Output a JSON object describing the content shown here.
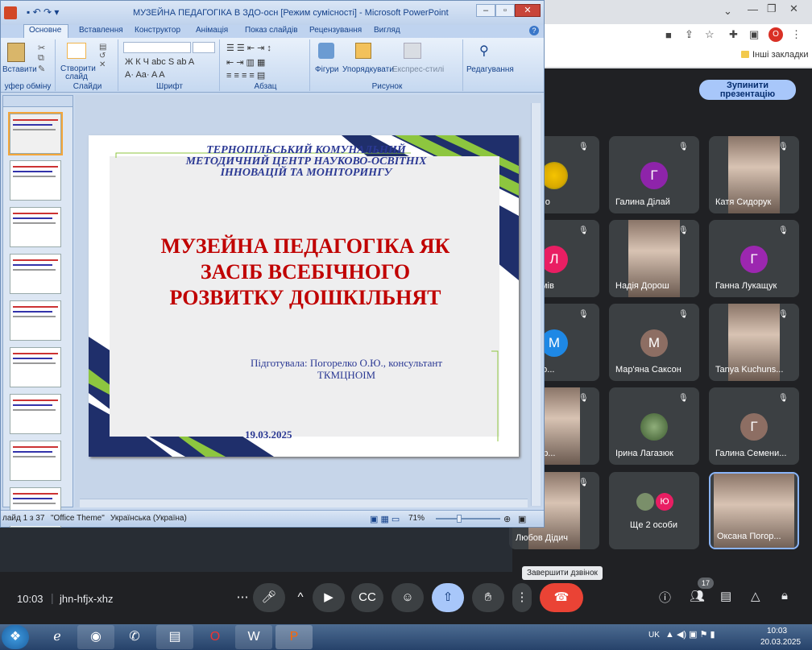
{
  "chrome": {
    "bookmark_folder": "Інші закладки",
    "profile_letter": "О"
  },
  "ppt": {
    "title": "МУЗЕЙНА ПЕДАГОГІКА В ЗДО-осн [Режим сумісності] - Microsoft PowerPoint",
    "tabs": [
      "Основне",
      "Вставлення",
      "Конструктор",
      "Анімація",
      "Показ слайдів",
      "Рецензування",
      "Вигляд"
    ],
    "groups": [
      "уфер обміну",
      "Слайди",
      "Шрифт",
      "Абзац",
      "Рисунок"
    ],
    "buttons": {
      "paste": "Вставити",
      "new_slide": "Створити слайд",
      "shapes": "Фігури",
      "arrange": "Упорядкувати",
      "quick_styles": "Експрес-стилі",
      "editing": "Редагування"
    },
    "slide": {
      "org_line1": "ТЕРНОПІЛЬСЬКИЙ КОМУНАЛЬНИЙ",
      "org_line2": "МЕТОДИЧНИЙ ЦЕНТР НАУКОВО-ОСВІТНІХ",
      "org_line3": "ІННОВАЦІЙ ТА  МОНІТОРИНГУ",
      "title_line1": "МУЗЕЙНА ПЕДАГОГІКА ЯК",
      "title_line2": "ЗАСІБ ВСЕБІЧНОГО",
      "title_line3": "РОЗВИТКУ ДОШКІЛЬНЯТ",
      "author_line1": "Підготувала: Погорелко О.Ю., консультант",
      "author_line2": "ТКМЦНОІМ",
      "date": "19.03.2025"
    },
    "status": {
      "slide_count": "лайд 1 з 37",
      "theme": "\"Office Theme\"",
      "language": "Українська (Україна)",
      "zoom": "71%"
    }
  },
  "meet": {
    "stop_presenting": "Зупинити презентацію",
    "participants": [
      {
        "name": "a Koshlo",
        "kind": "flower"
      },
      {
        "name": "Галина Ділай",
        "kind": "avatar",
        "letter": "Г",
        "color": "#8e24aa"
      },
      {
        "name": "Катя Сидорук",
        "kind": "photo"
      },
      {
        "name": "Максимів",
        "kind": "avatar",
        "letter": "Л",
        "color": "#e91e63"
      },
      {
        "name": "Надія Дорош",
        "kind": "photo"
      },
      {
        "name": "Ганна Лукащук",
        "kind": "avatar",
        "letter": "Г",
        "color": "#9c27b0"
      },
      {
        "name": "Дорожо...",
        "kind": "avatar",
        "letter": "М",
        "color": "#1e88e5"
      },
      {
        "name": "Мар'яна Саксон",
        "kind": "avatar",
        "letter": "М",
        "color": "#8d6e63"
      },
      {
        "name": "Tanya Kuchuns...",
        "kind": "photo"
      },
      {
        "name": "а Кондр...",
        "kind": "photo"
      },
      {
        "name": "Ірина Лагазюк",
        "kind": "photo-small"
      },
      {
        "name": "Галина Семени...",
        "kind": "avatar",
        "letter": "Г",
        "color": "#8d6e63"
      },
      {
        "name": "Любов Дідич",
        "kind": "photo"
      },
      {
        "name": "Ще 2 особи",
        "kind": "group",
        "letter": "Ю"
      },
      {
        "name": "Оксана Погор...",
        "kind": "photo-self"
      }
    ],
    "end_call_tooltip": "Завершити дзвінок",
    "time": "10:03",
    "meeting_code": "jhn-hfjx-xhz",
    "people_count": "17"
  },
  "taskbar": {
    "lang": "UK",
    "time": "10:03",
    "date": "20.03.2025"
  }
}
